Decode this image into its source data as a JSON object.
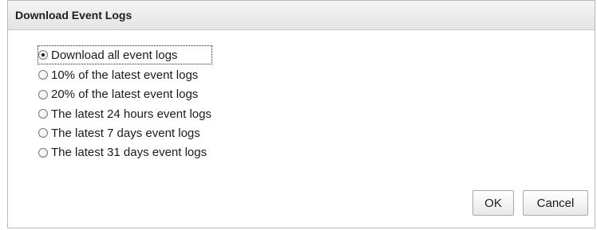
{
  "dialog": {
    "title": "Download Event Logs",
    "options": [
      {
        "label": "Download all event logs",
        "selected": true
      },
      {
        "label": "10% of the latest event logs",
        "selected": false
      },
      {
        "label": "20% of the latest event logs",
        "selected": false
      },
      {
        "label": "The latest 24 hours event logs",
        "selected": false
      },
      {
        "label": "The latest 7 days event logs",
        "selected": false
      },
      {
        "label": "The latest 31 days event logs",
        "selected": false
      }
    ],
    "ok_label": "OK",
    "cancel_label": "Cancel"
  }
}
